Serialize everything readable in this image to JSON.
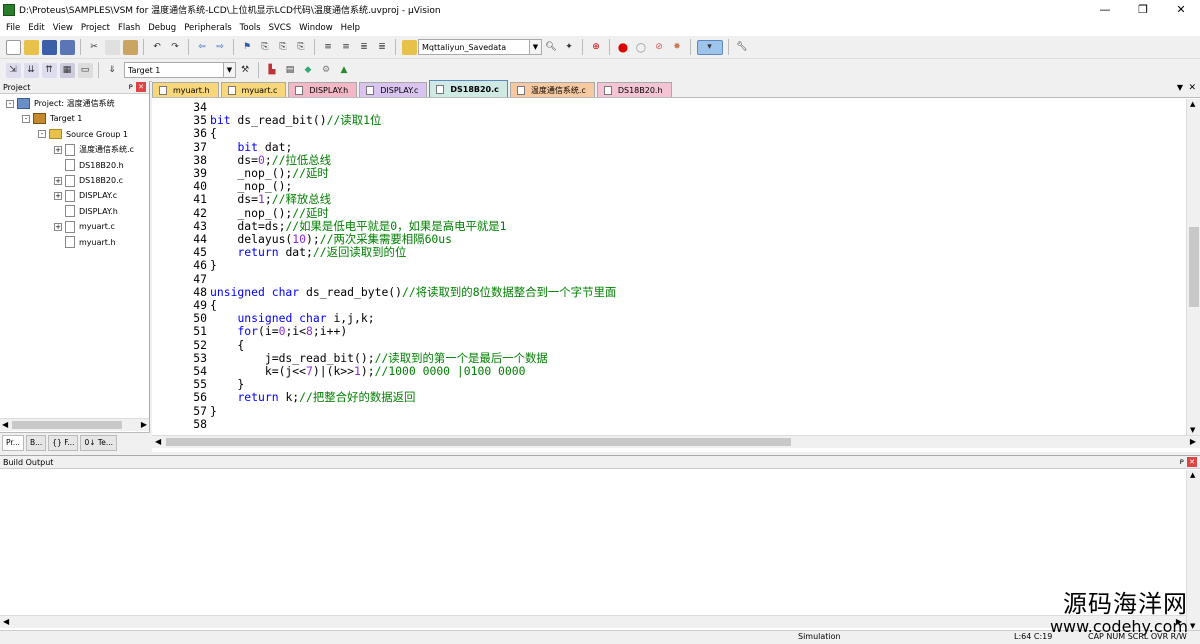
{
  "window": {
    "title": "D:\\Proteus\\SAMPLES\\VSM for 温度通信系统-LCD\\上位机显示LCD代码\\温度通信系统.uvproj - µVision",
    "controls": [
      "—",
      "❐",
      "✕"
    ]
  },
  "menu": [
    "File",
    "Edit",
    "View",
    "Project",
    "Flash",
    "Debug",
    "Peripherals",
    "Tools",
    "SVCS",
    "Window",
    "Help"
  ],
  "toolbar": {
    "find_combo": "Mqttaliyun_Savedata",
    "target_combo": "Target 1"
  },
  "project_panel": {
    "title": "Project",
    "tree": [
      {
        "label": "Project: 温度通信系统",
        "level": 0,
        "type": "project",
        "expander": "-"
      },
      {
        "label": "Target 1",
        "level": 1,
        "type": "target",
        "expander": "-"
      },
      {
        "label": "Source Group 1",
        "level": 2,
        "type": "folder",
        "expander": "-"
      },
      {
        "label": "温度通信系统.c",
        "level": 3,
        "type": "file",
        "expander": "+"
      },
      {
        "label": "DS18B20.h",
        "level": 3,
        "type": "file",
        "expander": ""
      },
      {
        "label": "DS18B20.c",
        "level": 3,
        "type": "file",
        "expander": "+"
      },
      {
        "label": "DISPLAY.c",
        "level": 3,
        "type": "file",
        "expander": "+"
      },
      {
        "label": "DISPLAY.h",
        "level": 3,
        "type": "file",
        "expander": ""
      },
      {
        "label": "myuart.c",
        "level": 3,
        "type": "file",
        "expander": "+"
      },
      {
        "label": "myuart.h",
        "level": 3,
        "type": "file",
        "expander": ""
      }
    ],
    "tabs": [
      {
        "label": "Pr...",
        "active": true
      },
      {
        "label": "B...",
        "active": false
      },
      {
        "label": "{} F...",
        "active": false
      },
      {
        "label": "0↓ Te...",
        "active": false
      }
    ]
  },
  "editor_tabs": [
    {
      "label": "myuart.h",
      "color": "#f7d77a",
      "active": false
    },
    {
      "label": "myuart.c",
      "color": "#f7d77a",
      "active": false
    },
    {
      "label": "DISPLAY.h",
      "color": "#f2b8c6",
      "active": false
    },
    {
      "label": "DISPLAY.c",
      "color": "#d9c4f0",
      "active": false
    },
    {
      "label": "DS18B20.c",
      "color": "#cfe9e4",
      "active": true
    },
    {
      "label": "温度通信系统.c",
      "color": "#f7c9a0",
      "active": false
    },
    {
      "label": "DS18B20.h",
      "color": "#f2c4d4",
      "active": false
    }
  ],
  "code_lines": [
    {
      "n": "34",
      "code": ""
    },
    {
      "n": "35",
      "code": "bit ds_read_bit()//读取1位"
    },
    {
      "n": "36",
      "code": "{"
    },
    {
      "n": "37",
      "code": "    bit dat;"
    },
    {
      "n": "38",
      "code": "    ds=0;//拉低总线"
    },
    {
      "n": "39",
      "code": "    _nop_();//延时"
    },
    {
      "n": "40",
      "code": "    _nop_();"
    },
    {
      "n": "41",
      "code": "    ds=1;//释放总线"
    },
    {
      "n": "42",
      "code": "    _nop_();//延时"
    },
    {
      "n": "43",
      "code": "    dat=ds;//如果是低电平就是0，如果是高电平就是1"
    },
    {
      "n": "44",
      "code": "    delayus(10);//两次采集需要相隔60us"
    },
    {
      "n": "45",
      "code": "    return dat;//返回读取到的位"
    },
    {
      "n": "46",
      "code": "}"
    },
    {
      "n": "47",
      "code": ""
    },
    {
      "n": "48",
      "code": "unsigned char ds_read_byte()//将读取到的8位数据整合到一个字节里面"
    },
    {
      "n": "49",
      "code": "{"
    },
    {
      "n": "50",
      "code": "    unsigned char i,j,k;"
    },
    {
      "n": "51",
      "code": "    for(i=0;i<8;i++)"
    },
    {
      "n": "52",
      "code": "    {"
    },
    {
      "n": "53",
      "code": "        j=ds_read_bit();//读取到的第一个是最后一个数据"
    },
    {
      "n": "54",
      "code": "        k=(j<<7)|(k>>1);//1000 0000 |0100 0000"
    },
    {
      "n": "55",
      "code": "    }"
    },
    {
      "n": "56",
      "code": "    return k;//把整合好的数据返回"
    },
    {
      "n": "57",
      "code": "}"
    },
    {
      "n": "58",
      "code": ""
    }
  ],
  "build_output": {
    "title": "Build Output"
  },
  "status": {
    "mode": "Simulation",
    "position": "L:64 C:19",
    "indicators": "CAP  NUM  SCRL  OVR  R/W"
  },
  "watermark": {
    "line1": "源码海洋网",
    "line2": "www.codehy.com"
  },
  "colors": {
    "keyword": "#0000ff",
    "comment": "#008000",
    "number": "#8a2be2"
  }
}
